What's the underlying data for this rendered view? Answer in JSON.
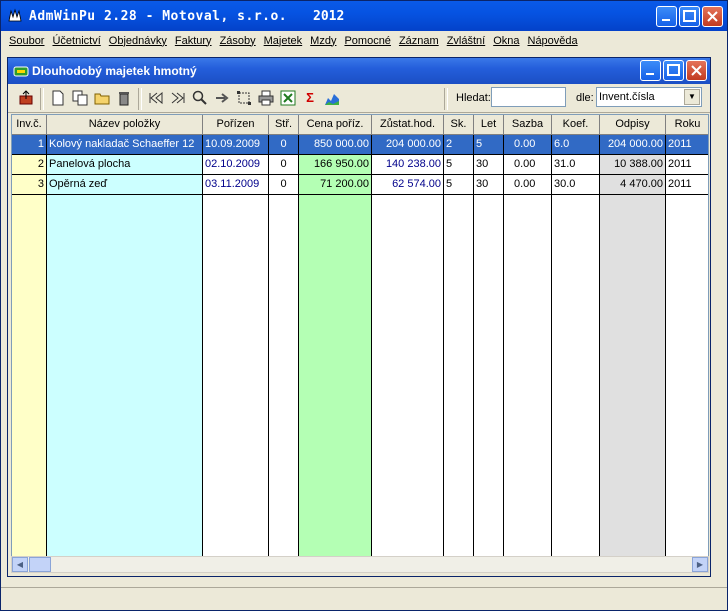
{
  "app": {
    "title": "AdmWinPu 2.28 - Motoval, s.r.o.",
    "year": "2012"
  },
  "menu": [
    "Soubor",
    "Účetnictví",
    "Objednávky",
    "Faktury",
    "Zásoby",
    "Majetek",
    "Mzdy",
    "Pomocné",
    "Záznam",
    "Zvláštní",
    "Okna",
    "Nápověda"
  ],
  "child": {
    "title": "Dlouhodobý majetek hmotný"
  },
  "search": {
    "label": "Hledat:",
    "value": "",
    "by_label": "dle:",
    "by_value": "Invent.čísla"
  },
  "icons": [
    "exit-icon",
    "new-icon",
    "copy-icon",
    "open-icon",
    "delete-icon",
    "first-record-icon",
    "last-record-icon",
    "find-icon",
    "next-icon",
    "select-icon",
    "print-icon",
    "excel-icon",
    "sum-icon",
    "chart-icon"
  ],
  "table": {
    "headers": [
      "Inv.č.",
      "Název položky",
      "Pořízen",
      "Stř.",
      "Cena poříz.",
      "Zůstat.hod.",
      "Sk.",
      "Let",
      "Sazba",
      "Koef.",
      "Odpisy",
      "Roku"
    ],
    "rows": [
      [
        "1",
        "Kolový nakladač Schaeffer 12",
        "10.09.2009",
        "0",
        "850 000.00",
        "204 000.00",
        "2",
        "5",
        "0.00",
        "6.0",
        "204 000.00",
        "2011"
      ],
      [
        "2",
        "Panelová plocha",
        "02.10.2009",
        "0",
        "166 950.00",
        "140 238.00",
        "5",
        "30",
        "0.00",
        "31.0",
        "10 388.00",
        "2011"
      ],
      [
        "3",
        "Opěrná zeď",
        "03.11.2009",
        "0",
        "71 200.00",
        "62 574.00",
        "5",
        "30",
        "0.00",
        "30.0",
        "4 470.00",
        "2011"
      ]
    ]
  },
  "colors": {
    "title_bar": "#0653e2",
    "selection": "#316ac5",
    "inv_column": "#ffffc8",
    "name_column": "#ccffff",
    "price_column": "#b4ffb4",
    "odpisy_column": "#e0e0e0"
  }
}
